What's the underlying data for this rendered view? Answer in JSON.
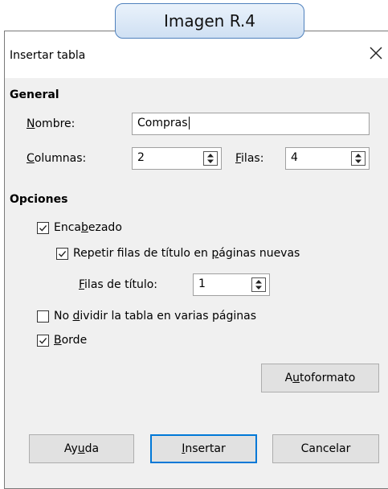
{
  "caption": "Imagen R.4",
  "window": {
    "title": "Insertar tabla",
    "close_glyph": "×"
  },
  "general": {
    "heading": "General",
    "name": {
      "label_pre": "",
      "label_u": "N",
      "label_post": "ombre:",
      "value": "Compras"
    },
    "columns": {
      "label_pre": "",
      "label_u": "C",
      "label_post": "olumnas:",
      "value": "2"
    },
    "rows": {
      "label_pre": "",
      "label_u": "F",
      "label_post": "ilas:",
      "value": "4"
    }
  },
  "options": {
    "heading": "Opciones",
    "header": {
      "pre": "Enca",
      "u": "b",
      "post": "ezado",
      "checked": true
    },
    "repeat": {
      "pre": "Repetir filas de título en ",
      "u": "p",
      "post": "áginas nuevas",
      "checked": true
    },
    "title_rows": {
      "pre": "",
      "u": "F",
      "post": "ilas de título:",
      "value": "1"
    },
    "no_split": {
      "pre": "No ",
      "u": "d",
      "post": "ividir la tabla en varias páginas",
      "checked": false
    },
    "border": {
      "pre": "",
      "u": "B",
      "post": "orde",
      "checked": true
    }
  },
  "buttons": {
    "autoformat": {
      "pre": "A",
      "u": "u",
      "post": "toformato"
    },
    "help": {
      "pre": "Ay",
      "u": "u",
      "post": "da"
    },
    "insert": {
      "pre": "",
      "u": "I",
      "post": "nsertar"
    },
    "cancel": {
      "pre": "Cancelar",
      "u": "",
      "post": ""
    }
  },
  "icons": {
    "close": "close-icon",
    "spin": "spin-arrows-icon",
    "check": "checkmark-icon"
  },
  "colors": {
    "default_button_border": "#0078d7",
    "caption_border": "#4f81bd"
  }
}
